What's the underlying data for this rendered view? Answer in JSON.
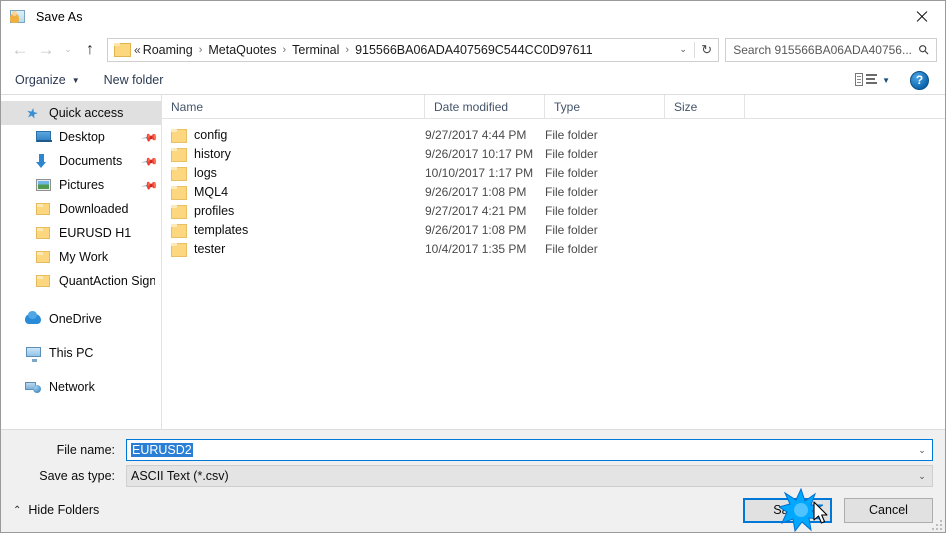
{
  "window": {
    "title": "Save As",
    "icon": "save-as-icon",
    "close_label": "✕"
  },
  "navbar": {
    "back_icon": "back-arrow-icon",
    "back_glyph": "←",
    "forward_icon": "forward-arrow-icon",
    "forward_glyph": "→",
    "recent_icon": "recent-locations-chevron-icon",
    "recent_glyph": "⌄",
    "up_icon": "up-arrow-icon",
    "up_glyph": "↑",
    "folder_icon": "folder-icon",
    "breadcrumb_prefix": "«",
    "breadcrumbs": [
      "Roaming",
      "MetaQuotes",
      "Terminal",
      "915566BA06ADA407569C544CC0D97611"
    ],
    "breadcrumb_separator": "›",
    "dropdown_glyph": "⌄",
    "refresh_icon": "refresh-icon",
    "refresh_glyph": "↻",
    "search_placeholder": "Search 915566BA06ADA40756...",
    "search_icon": "search-icon",
    "search_glyph": "⚲"
  },
  "toolbar": {
    "organize_label": "Organize",
    "organize_caret": "▼",
    "new_folder_label": "New folder",
    "view_icon": "view-layout-icon",
    "view_caret": "▼",
    "help_label": "?",
    "help_icon": "help-icon"
  },
  "sidebar": {
    "items": [
      {
        "label": "Quick access",
        "icon": "star-icon",
        "indent": 0,
        "selected": true,
        "pinned": false
      },
      {
        "label": "Desktop",
        "icon": "desktop-icon",
        "indent": 1,
        "selected": false,
        "pinned": true
      },
      {
        "label": "Documents",
        "icon": "documents-icon",
        "indent": 1,
        "selected": false,
        "pinned": true
      },
      {
        "label": "Pictures",
        "icon": "pictures-icon",
        "indent": 1,
        "selected": false,
        "pinned": true
      },
      {
        "label": "Downloaded",
        "icon": "folder-icon",
        "indent": 1,
        "selected": false,
        "pinned": false
      },
      {
        "label": "EURUSD H1",
        "icon": "folder-icon",
        "indent": 1,
        "selected": false,
        "pinned": false
      },
      {
        "label": "My Work",
        "icon": "folder-icon",
        "indent": 1,
        "selected": false,
        "pinned": false
      },
      {
        "label": "QuantAction Signal",
        "icon": "folder-icon",
        "indent": 1,
        "selected": false,
        "pinned": false
      },
      {
        "label": "OneDrive",
        "icon": "onedrive-icon",
        "indent": 0,
        "selected": false,
        "pinned": false
      },
      {
        "label": "This PC",
        "icon": "this-pc-icon",
        "indent": 0,
        "selected": false,
        "pinned": false
      },
      {
        "label": "Network",
        "icon": "network-icon",
        "indent": 0,
        "selected": false,
        "pinned": false
      }
    ],
    "pin_glyph": "📌"
  },
  "filelist": {
    "columns": [
      {
        "label": "Name",
        "sorted": true,
        "sort_glyph": "⌃"
      },
      {
        "label": "Date modified",
        "sorted": false,
        "sort_glyph": ""
      },
      {
        "label": "Type",
        "sorted": false,
        "sort_glyph": ""
      },
      {
        "label": "Size",
        "sorted": false,
        "sort_glyph": ""
      }
    ],
    "rows": [
      {
        "name": "config",
        "date": "9/27/2017 4:44 PM",
        "type": "File folder",
        "size": ""
      },
      {
        "name": "history",
        "date": "9/26/2017 10:17 PM",
        "type": "File folder",
        "size": ""
      },
      {
        "name": "logs",
        "date": "10/10/2017 1:17 PM",
        "type": "File folder",
        "size": ""
      },
      {
        "name": "MQL4",
        "date": "9/26/2017 1:08 PM",
        "type": "File folder",
        "size": ""
      },
      {
        "name": "profiles",
        "date": "9/27/2017 4:21 PM",
        "type": "File folder",
        "size": ""
      },
      {
        "name": "templates",
        "date": "9/26/2017 1:08 PM",
        "type": "File folder",
        "size": ""
      },
      {
        "name": "tester",
        "date": "10/4/2017 1:35 PM",
        "type": "File folder",
        "size": ""
      }
    ]
  },
  "form": {
    "filename_label": "File name:",
    "filename_value": "EURUSD2",
    "filename_selected": true,
    "filetype_label": "Save as type:",
    "filetype_value": "ASCII Text (*.csv)",
    "dropdown_glyph": "⌄"
  },
  "footer": {
    "hide_folders_label": "Hide Folders",
    "hide_folders_caret": "⌃",
    "save_label": "Save",
    "cancel_label": "Cancel"
  },
  "colors": {
    "accent": "#0078d7",
    "selection": "#2a7fd4",
    "folder": "#fcd77f",
    "header_text": "#44546a",
    "chrome_bg": "#f0f0f0",
    "click_fx": "#00a2ff"
  }
}
